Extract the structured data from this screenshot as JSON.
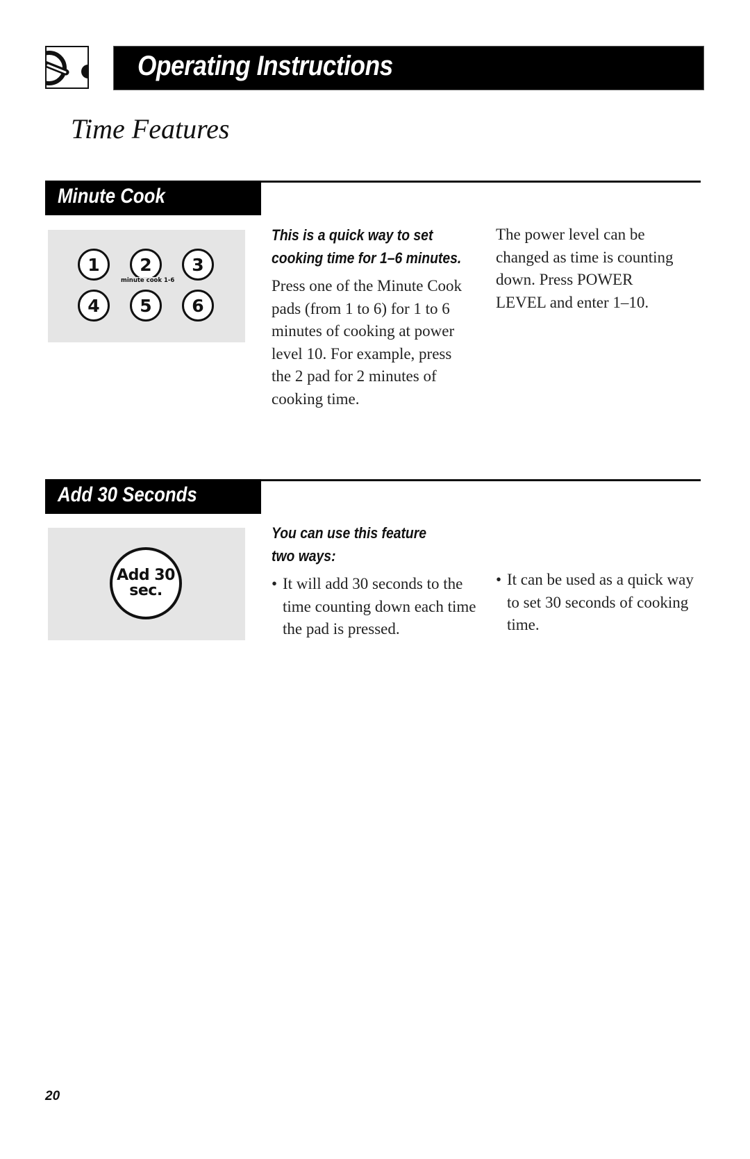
{
  "header": {
    "logo_icon": "control-dial-icon",
    "title": "Operating Instructions"
  },
  "page_title": "Time Features",
  "sections": [
    {
      "title": "Minute Cook",
      "illustration": {
        "pads": [
          "1",
          "2",
          "3",
          "4",
          "5",
          "6"
        ],
        "caption": "minute cook 1-6"
      },
      "lead": [
        "This is a quick way to set",
        "cooking time for 1–6 minutes."
      ],
      "body": "Press one of the Minute Cook pads (from 1 to 6) for 1 to 6 minutes of cooking at power level 10. For example, press the 2 pad for 2 minutes of cooking time.",
      "side_text": "The power level can be changed as time is counting down. Press POWER LEVEL and enter 1–10."
    },
    {
      "title": "Add 30 Seconds",
      "illustration": {
        "pad_line1": "Add 30",
        "pad_line2": "sec."
      },
      "lead": [
        "You can use this feature",
        "two ways:"
      ],
      "bullets": [
        "It will add 30 seconds to the time counting down each time the pad is pressed.",
        "It can be used as a quick way to set 30 seconds of cooking time."
      ],
      "bullet_glyph": "•"
    }
  ],
  "page_number": "20"
}
